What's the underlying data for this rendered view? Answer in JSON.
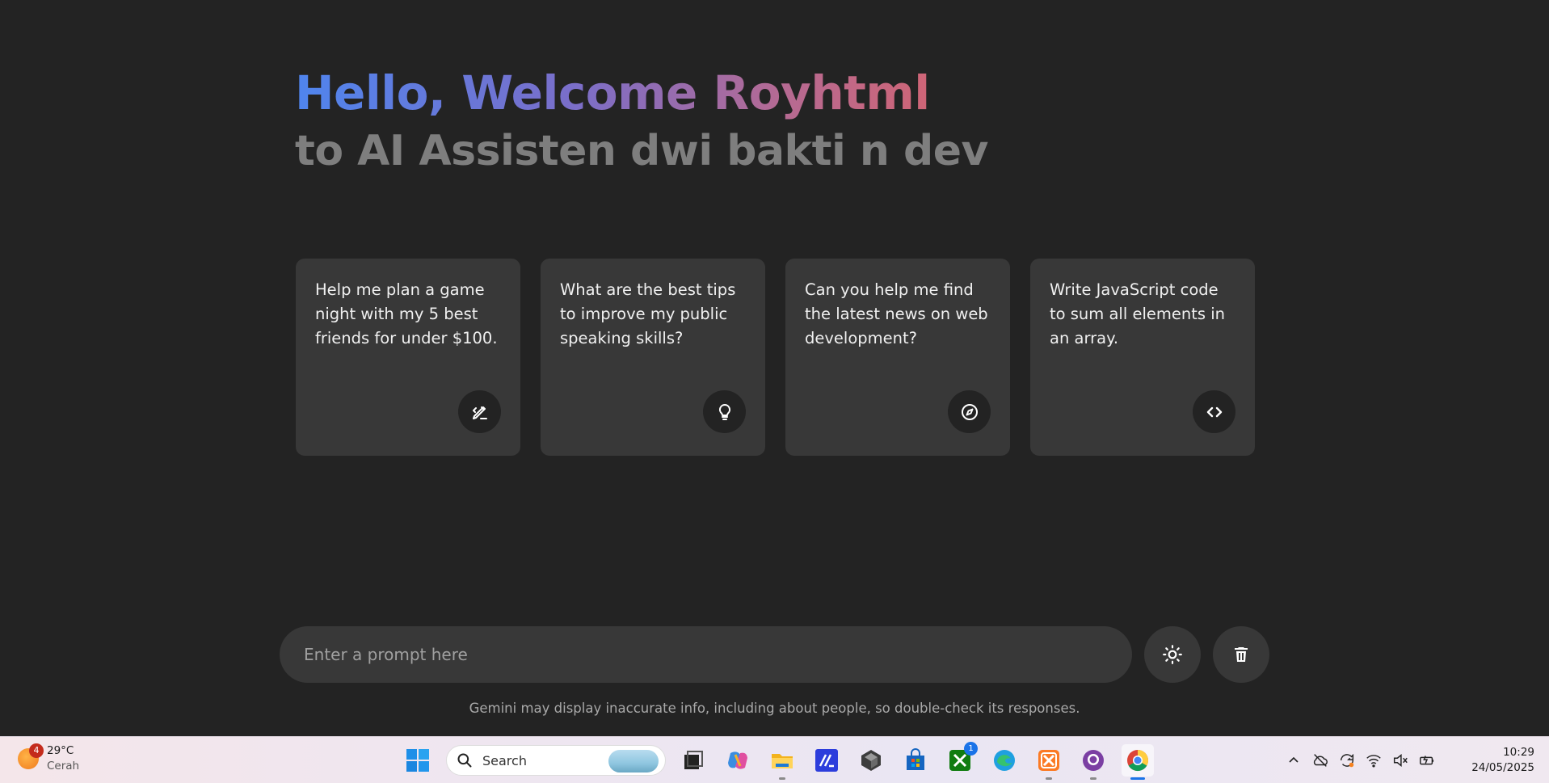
{
  "greeting": {
    "title": "Hello, Welcome Royhtml",
    "subtitle": "to AI Assisten dwi bakti n dev"
  },
  "suggestions": [
    {
      "text": "Help me plan a game night with my 5 best friends for under $100.",
      "icon": "draw-icon"
    },
    {
      "text": "What are the best tips to improve my public speaking skills?",
      "icon": "lightbulb-icon"
    },
    {
      "text": "Can you help me find the latest news on web development?",
      "icon": "explore-icon"
    },
    {
      "text": "Write JavaScript code to sum all elements in an array.",
      "icon": "code-icon"
    }
  ],
  "prompt": {
    "placeholder": "Enter a prompt here",
    "theme_icon": "sun-icon",
    "delete_icon": "trash-icon"
  },
  "disclaimer": "Gemini may display inaccurate info, including about people, so double-check its responses.",
  "taskbar": {
    "weather": {
      "badge": "4",
      "temp": "29°C",
      "condition": "Cerah"
    },
    "search_label": "Search",
    "xbox_badge": "1",
    "apps": [
      "start-icon",
      "task-view-icon",
      "copilot-icon",
      "file-explorer-icon",
      "visual-studio-icon",
      "unity-icon",
      "store-icon",
      "xbox-icon",
      "edge-icon",
      "xampp-icon",
      "github-desktop-icon",
      "chrome-icon"
    ],
    "clock": {
      "time": "10:29",
      "date": "24/05/2025"
    }
  },
  "colors": {
    "background": "#232323",
    "card": "#383838",
    "gradient_start": "#4f85ee",
    "gradient_end": "#d9636b",
    "subtitle": "#7e7e7e"
  }
}
